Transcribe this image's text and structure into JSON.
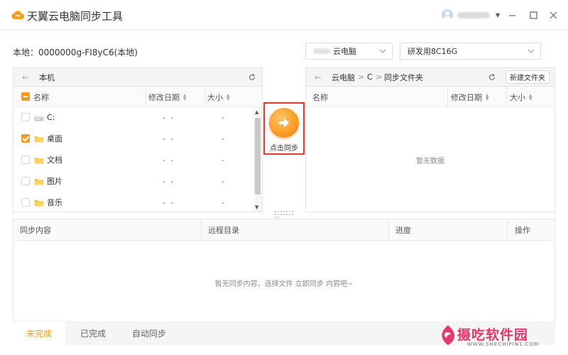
{
  "app": {
    "title": "天翼云电脑同步工具"
  },
  "local": {
    "label": "本地：0000000g-FI8yC6(本地)"
  },
  "remote": {
    "computer_select": "云电脑",
    "device_select": "研发用8C16G"
  },
  "left_panel": {
    "nav_title": "本机",
    "columns": {
      "name": "名称",
      "date": "修改日期",
      "size": "大小"
    },
    "rows": [
      {
        "name": "C:",
        "date": "- -",
        "size": "-",
        "checked": false,
        "type": "drive"
      },
      {
        "name": "桌面",
        "date": "- -",
        "size": "-",
        "checked": true,
        "type": "folder"
      },
      {
        "name": "文档",
        "date": "- -",
        "size": "-",
        "checked": false,
        "type": "folder"
      },
      {
        "name": "图片",
        "date": "- -",
        "size": "-",
        "checked": false,
        "type": "folder"
      },
      {
        "name": "音乐",
        "date": "- -",
        "size": "-",
        "checked": false,
        "type": "folder"
      }
    ]
  },
  "right_panel": {
    "breadcrumb": [
      "云电脑",
      "C",
      "同步文件夹"
    ],
    "breadcrumb_sep": ">",
    "new_folder_label": "新建文件夹",
    "columns": {
      "name": "名称",
      "date": "修改日期",
      "size": "大小"
    },
    "empty_text": "暂无数据"
  },
  "sync_button": {
    "label": "点击同步"
  },
  "tasks": {
    "columns": {
      "content": "同步内容",
      "remote_dir": "远程目录",
      "progress": "进度",
      "actions": "操作"
    },
    "empty_text": "暂无同步内容，选择文件 立即同步 内容吧~"
  },
  "tabs": [
    {
      "label": "未完成",
      "active": true
    },
    {
      "label": "已完成",
      "active": false
    },
    {
      "label": "自动同步",
      "active": false
    }
  ],
  "watermark": {
    "name": "摄吃软件园",
    "url": "WWW.SHECHIPIN1.COM"
  },
  "colors": {
    "accent": "#f59a23",
    "highlight_border": "#e53935",
    "watermark": "#e5386b"
  }
}
